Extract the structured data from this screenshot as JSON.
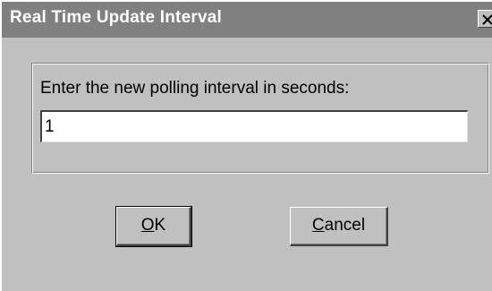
{
  "window": {
    "title": "Real Time Update Interval",
    "close_icon": "close-icon"
  },
  "form": {
    "prompt": "Enter the new polling interval in seconds:",
    "interval_value": "1"
  },
  "buttons": {
    "ok_mnemonic": "O",
    "ok_rest": "K",
    "cancel_mnemonic": "C",
    "cancel_rest": "ancel"
  },
  "colors": {
    "title_bar": "#808080",
    "face": "#c0c0c0"
  }
}
